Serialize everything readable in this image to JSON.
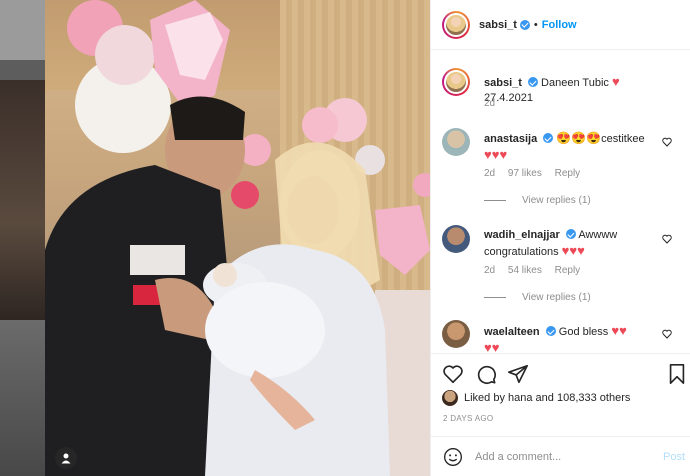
{
  "post": {
    "username": "sabsi_t",
    "follow_label": "Follow",
    "separator": "•",
    "caption": {
      "username": "sabsi_t",
      "text": "Daneen Tubic",
      "date": "27.4.2021",
      "age": "2d"
    }
  },
  "comments": [
    {
      "username": "anastasija",
      "text": "cestitkee",
      "age": "2d",
      "likes": "97 likes",
      "reply": "Reply",
      "view_replies": "View replies (1)"
    },
    {
      "username": "wadih_elnajjar",
      "text": "Awwww congratulations",
      "age": "2d",
      "likes": "54 likes",
      "reply": "Reply",
      "view_replies": "View replies (1)"
    },
    {
      "username": "waelalteen",
      "text": "God bless"
    }
  ],
  "likes_line": "Liked by hana and 108,333 others",
  "time_ago": "2 DAYS AGO",
  "comment_box": {
    "placeholder": "Add a comment...",
    "post_label": "Post"
  },
  "colors": {
    "accent": "#0095f6",
    "heart": "#ed4956",
    "muted": "#8e8e8e"
  }
}
